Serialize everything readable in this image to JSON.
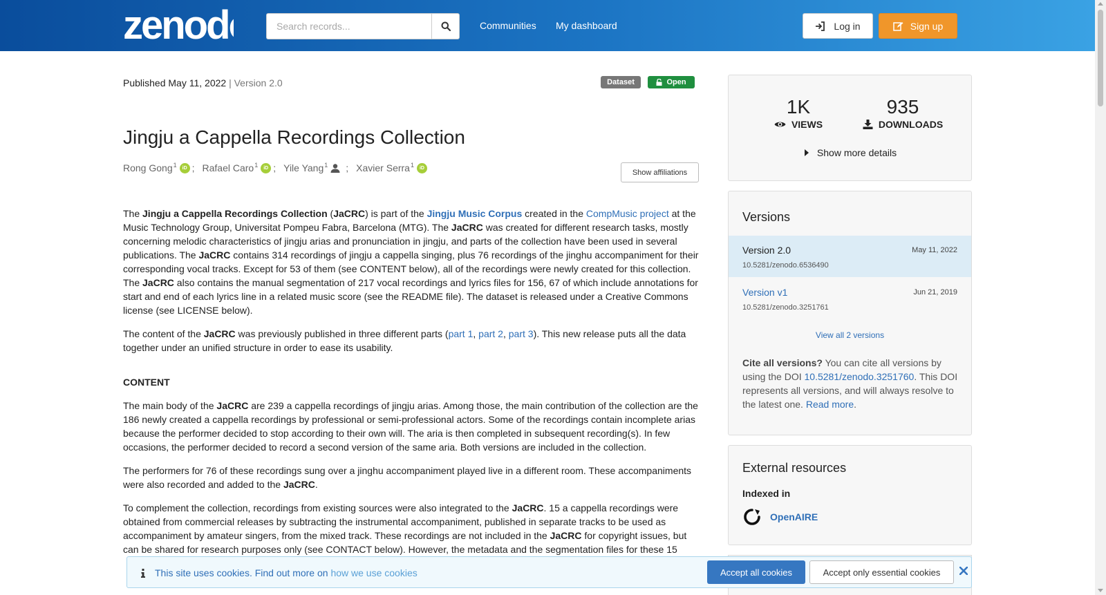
{
  "header": {
    "logo_text": "zenodo",
    "search": {
      "placeholder": "Search records...",
      "value": ""
    },
    "nav": {
      "communities": "Communities",
      "dashboard": "My dashboard"
    },
    "login_label": "Log in",
    "signup_label": "Sign up"
  },
  "record": {
    "published_label": "Published May 11, 2022",
    "version_label": "| Version 2.0",
    "badge_type": "Dataset",
    "badge_access": "Open",
    "title": "Jingju a Cappella Recordings Collection",
    "authors": [
      {
        "name": "Rong Gong",
        "aff": "1"
      },
      {
        "name": "Rafael Caro",
        "aff": "1"
      },
      {
        "name": "Yile Yang",
        "aff": "1"
      },
      {
        "name": "Xavier Serra",
        "aff": "1"
      }
    ],
    "author_separator": ";",
    "show_affiliations": "Show affiliations"
  },
  "description": {
    "p1": [
      "The ",
      "Jingju a Cappella Recordings Collection",
      " (",
      "JaCRC",
      ") is part of the ",
      "Jingju Music Corpus",
      " created in the ",
      "CompMusic project",
      " at the Music Technology Group, Universitat Pompeu Fabra, Barcelona (MTG). The ",
      "JaCRC",
      " was created for different research tasks, mostly concerning melodic characteristics of jingju arias and pronunciation in jingju, and parts of the collection have been used in several publications. The ",
      "JaCRC",
      " contains 314 recordings of jingju a cappella singing, plus 76 recordings of the jinghu accompaniment for their corresponding vocal tracks. Except for 53 of them (see CONTENT below), all of the recordings were newly created for this collection. The ",
      "JaCRC",
      " also contains the manual segmentation of 217 vocal recordings and lyrics files for 156, 67 of which include annotations for start and end of each lyrics line in a related music score (see the README file). The dataset is released under a Creative Commons license (see LICENSE below)."
    ],
    "p2": [
      "The content of the ",
      "JaCRC",
      " was previously published in three different parts (",
      "part 1",
      ", ",
      "part 2",
      ", ",
      "part 3",
      "). This new release puts all the data together under an unified structure in order to ease its usability."
    ],
    "content_heading": "CONTENT",
    "p3": [
      "The main body of the ",
      "JaCRC",
      " are 239 a cappella recordings of jingju arias. Among those, the main contribution of the collection are the 186 newly created a cappella recordings by professional or semi-professional actors. Some of the recordings contain incomplete arias because the performer decided to stop according to their own will. The aria is then completed in subsequent recording(s). In few occasions, the performer decided to record a second version of the same aria. Both versions are included in the collection."
    ],
    "p4": [
      "The performers for 76 of these recordings sung over a jinghu accompaniment played live in a different room. These accompaniments were also recorded and added to the ",
      "JaCRC",
      "."
    ],
    "p5": [
      "To complement the collection, recordings from existing sources were also integrated to the ",
      "JaCRC",
      ". 15 a cappella recordings were obtained from commercial releases by subtracting the instrumental accompaniment, published in separate tracks to be used as accompaniment by amateur singers, from the mixed track. These recordings are not included in the ",
      "JaCRC",
      " for copyright issues, but can be shared for research purposes only (see CONTACT below). However, the metadata and the segmentation files for these 15"
    ]
  },
  "stats": {
    "views": "1K",
    "views_label": "VIEWS",
    "downloads": "935",
    "downloads_label": "DOWNLOADS",
    "more_details": "Show more details"
  },
  "versions": {
    "heading": "Versions",
    "items": [
      {
        "name": "Version 2.0",
        "date": "May 11, 2022",
        "doi": "10.5281/zenodo.6536490"
      },
      {
        "name": "Version v1",
        "date": "Jun 21, 2019",
        "doi": "10.5281/zenodo.3251761"
      }
    ],
    "view_all": "View all 2 versions",
    "cite_bold": "Cite all versions?",
    "cite_text1": " You can cite all versions by using the DOI ",
    "cite_doi": "10.5281/zenodo.3251760",
    "cite_text2": ". This DOI represents all versions, and will always resolve to the latest one. ",
    "cite_read_more": "Read more",
    "cite_end": "."
  },
  "external": {
    "heading": "External resources",
    "indexed_in": "Indexed in",
    "openaire": "OpenAIRE"
  },
  "cookie": {
    "message": "This site uses cookies. Find out more on ",
    "link": "how we use cookies",
    "accept_all": "Accept all cookies",
    "accept_essential": "Accept only essential cookies"
  },
  "colors": {
    "header_start": "#0a4d9c",
    "header_end": "#3aa2e4",
    "signup": "#f0962a",
    "open_badge": "#1f8f3f",
    "link": "#2f6fb7"
  }
}
